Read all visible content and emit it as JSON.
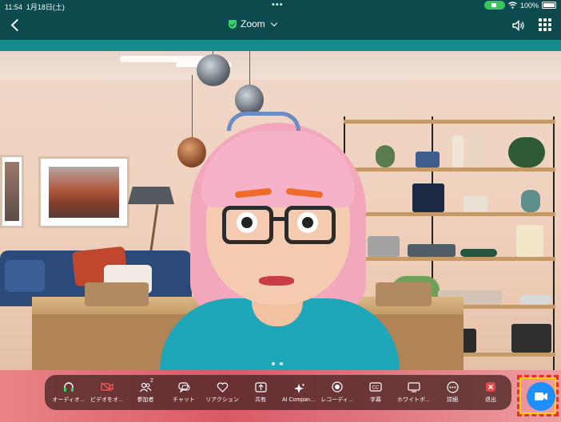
{
  "status": {
    "time": "11:54",
    "date": "1月18日(土)",
    "dots": "•••",
    "battery": "100%"
  },
  "nav": {
    "title": "Zoom"
  },
  "toolbar": {
    "items": [
      {
        "label": "オーディオ…",
        "icon": "headphones-icon"
      },
      {
        "label": "ビデオをオ…",
        "icon": "video-off-icon"
      },
      {
        "label": "参加者",
        "icon": "participants-icon",
        "badge": "2"
      },
      {
        "label": "チャット",
        "icon": "chat-icon"
      },
      {
        "label": "リアクション",
        "icon": "heart-icon"
      },
      {
        "label": "共有",
        "icon": "share-icon"
      },
      {
        "label": "AI Compan…",
        "icon": "sparkle-icon"
      },
      {
        "label": "レコーディ…",
        "icon": "record-icon"
      },
      {
        "label": "字幕",
        "icon": "captions-icon"
      },
      {
        "label": "ホワイトボ…",
        "icon": "whiteboard-icon"
      },
      {
        "label": "詳細",
        "icon": "more-icon"
      },
      {
        "label": "退出",
        "icon": "leave-icon"
      }
    ]
  },
  "colors": {
    "header": "#0c4a4e",
    "strip": "#188b8d",
    "fab": "#1e8fff",
    "leave": "#e24848",
    "highlight": "#e53020"
  }
}
